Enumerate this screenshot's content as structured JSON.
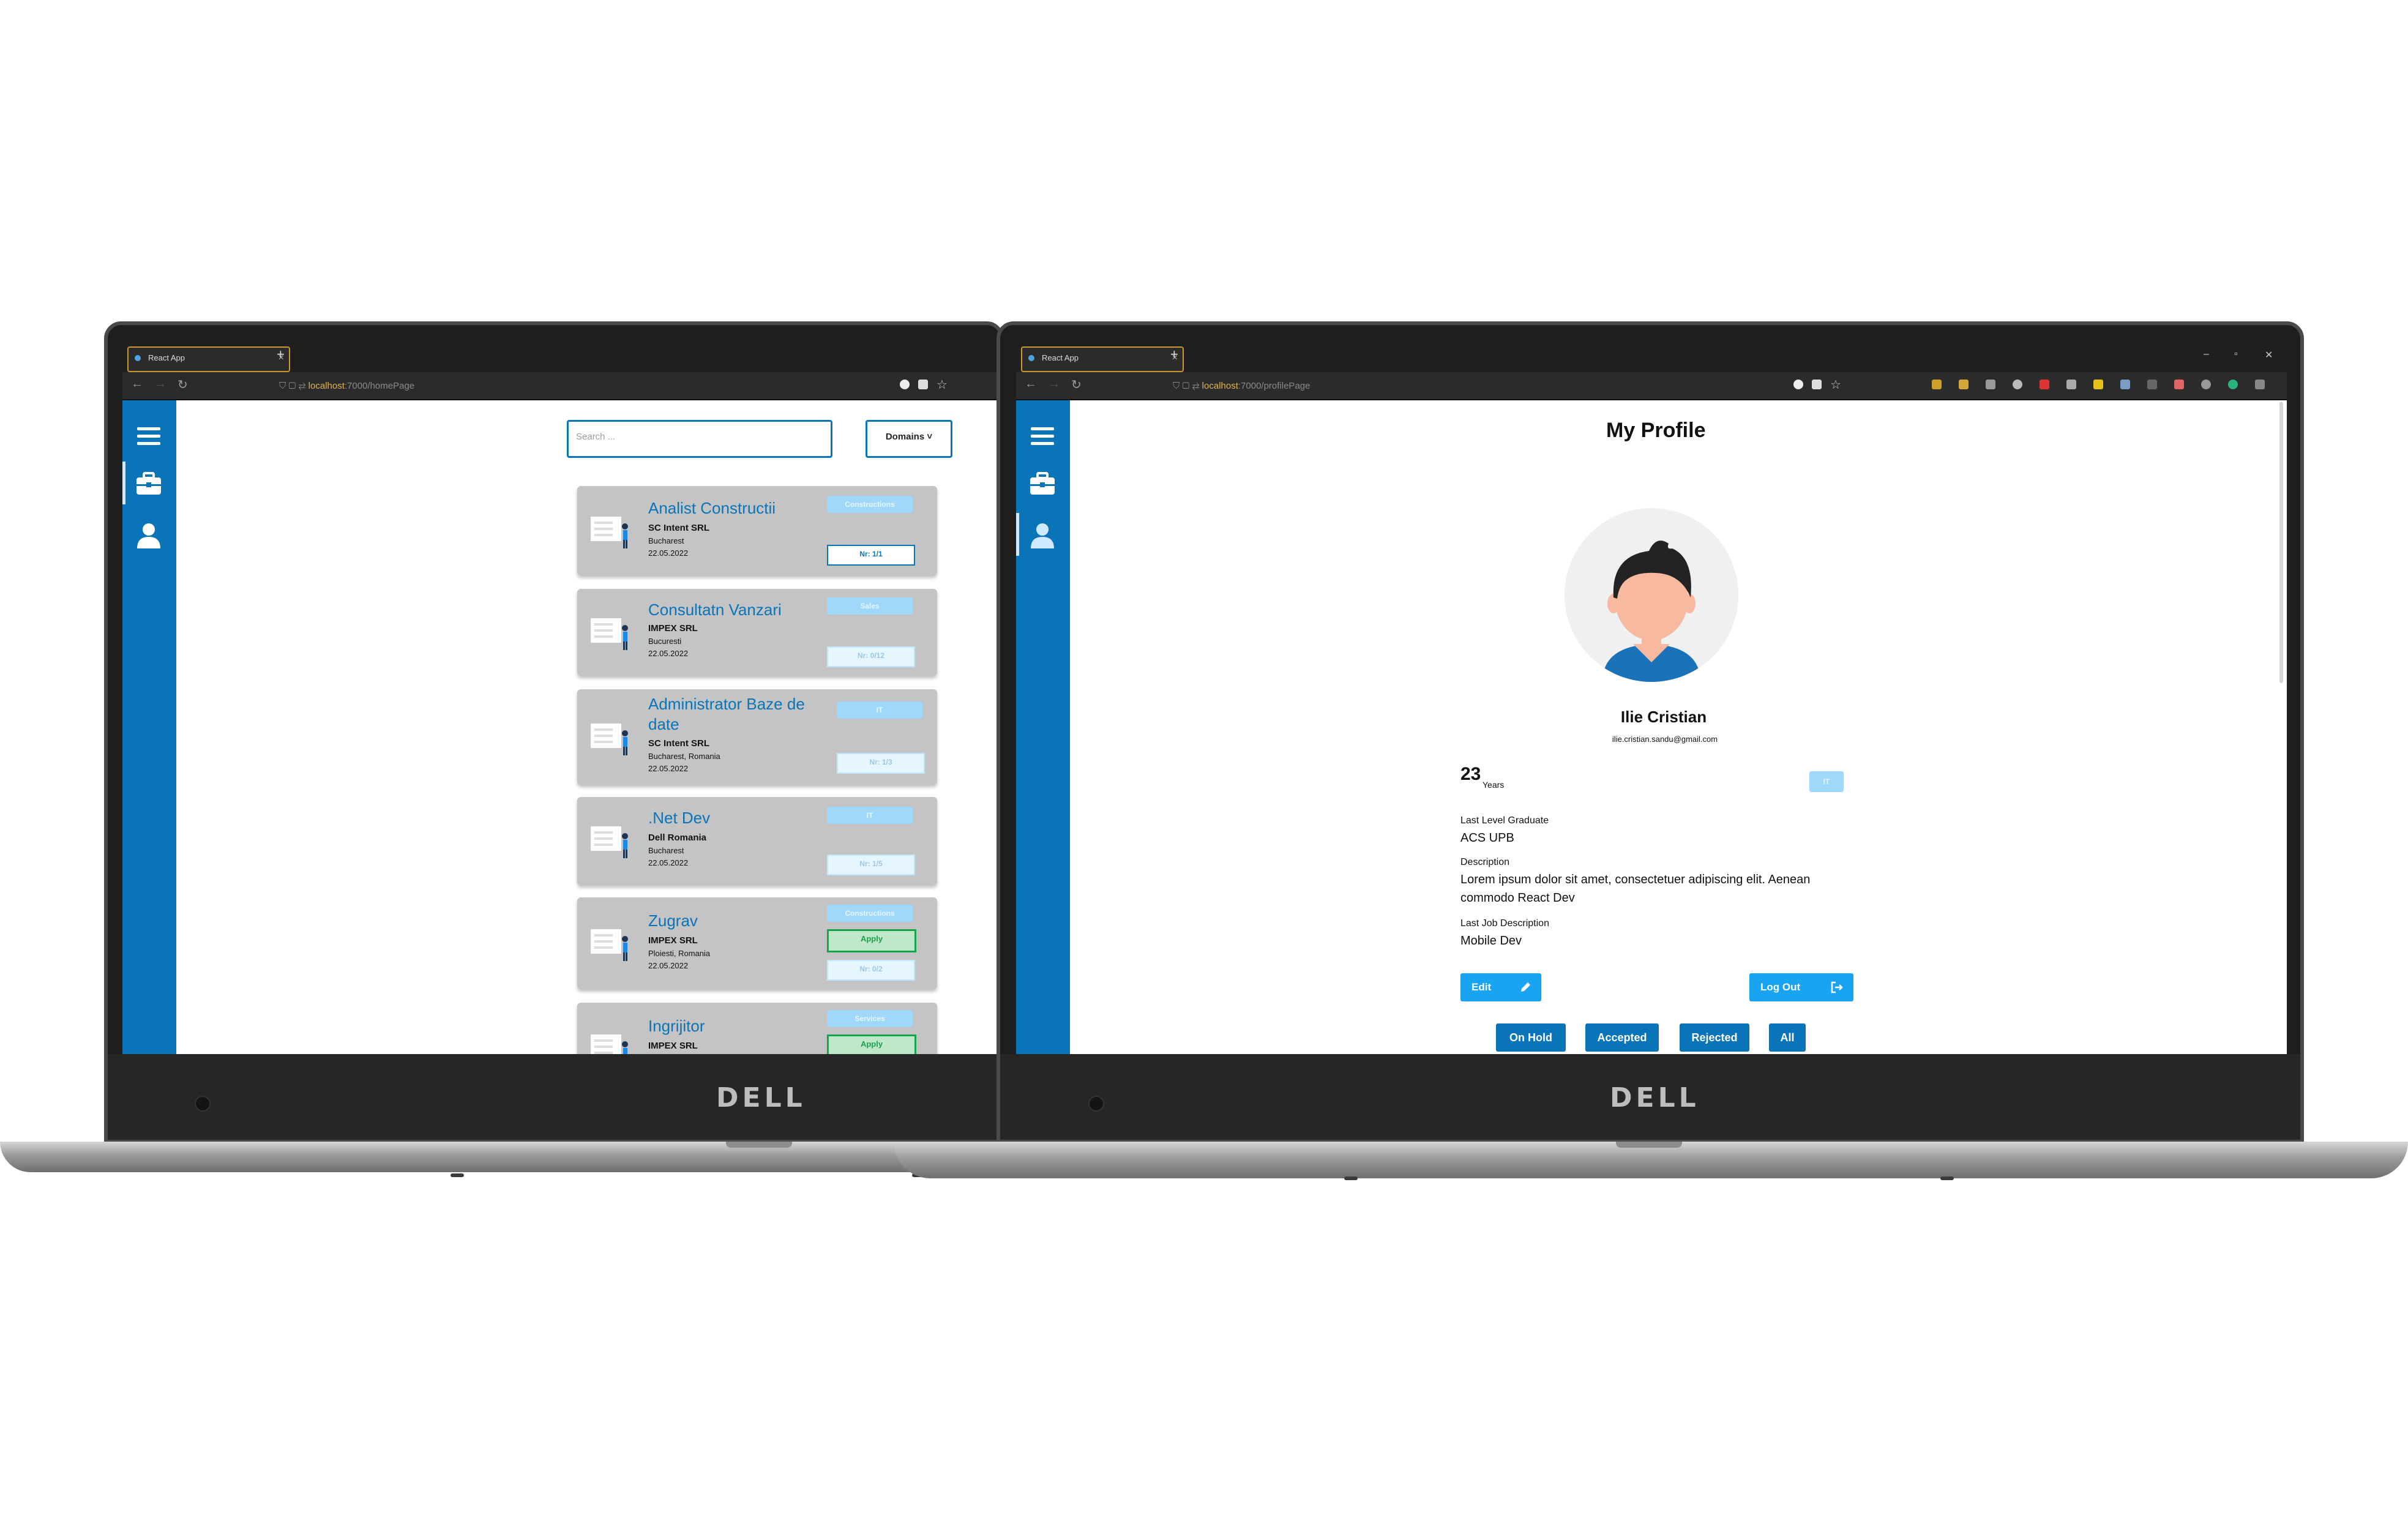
{
  "left_screen": {
    "tab_title": "React App",
    "url_host": "localhost",
    "url_path": ":7000/homePage",
    "search_placeholder": "Search ...",
    "domains_label": "Domains",
    "jobs": [
      {
        "title": "Analist Constructii",
        "company": "SC Intent SRL",
        "location": "Bucharest",
        "date": "22.05.2022",
        "domain": "Constructions",
        "nr": "Nr: 1/1"
      },
      {
        "title": "Consultatn Vanzari",
        "company": "IMPEX SRL",
        "location": "Bucuresti",
        "date": "22.05.2022",
        "domain": "Sales",
        "nr": "Nr: 0/12"
      },
      {
        "title": "Administrator Baze de date",
        "company": "SC Intent SRL",
        "location": "Bucharest, Romania",
        "date": "22.05.2022",
        "domain": "IT",
        "nr": "Nr: 1/3"
      },
      {
        "title": ".Net Dev",
        "company": "Dell Romania",
        "location": "Bucharest",
        "date": "22.05.2022",
        "domain": "IT",
        "nr": "Nr: 1/5"
      },
      {
        "title": "Zugrav",
        "company": "IMPEX SRL",
        "location": "Ploiesti, Romania",
        "date": "22.05.2022",
        "domain": "Constructions",
        "apply": "Apply",
        "nr": "Nr: 0/2"
      },
      {
        "title": "Ingrijitor",
        "company": "IMPEX SRL",
        "domain": "Services",
        "apply": "Apply"
      }
    ],
    "brand": "DELL"
  },
  "right_screen": {
    "tab_title": "React App",
    "url_host": "localhost",
    "url_path": ":7000/profilePage",
    "page_title": "My Profile",
    "name": "Ilie Cristian",
    "email": "ilie.cristian.sandu@gmail.com",
    "age": "23",
    "age_unit": "Years",
    "domain_badge": "IT",
    "last_level_label": "Last Level Graduate",
    "last_level": "ACS UPB",
    "description_label": "Description",
    "description": "Lorem ipsum dolor sit amet, consectetuer adipiscing elit. Aenean commodo React Dev",
    "last_job_label": "Last Job Description",
    "last_job": "Mobile Dev",
    "edit_label": "Edit",
    "logout_label": "Log Out",
    "filters": [
      "On Hold",
      "Accepted",
      "Rejected",
      "All"
    ],
    "brand": "DELL"
  },
  "colors": {
    "primary": "#0a74b8",
    "accent": "#18a4f0",
    "card": "#c4c4c4",
    "badge": "#9fd8fb",
    "apply": "#16a34a"
  },
  "icons": [
    "hamburger-icon",
    "briefcase-icon",
    "user-icon",
    "pencil-icon",
    "logout-icon",
    "chevron-down-icon"
  ]
}
